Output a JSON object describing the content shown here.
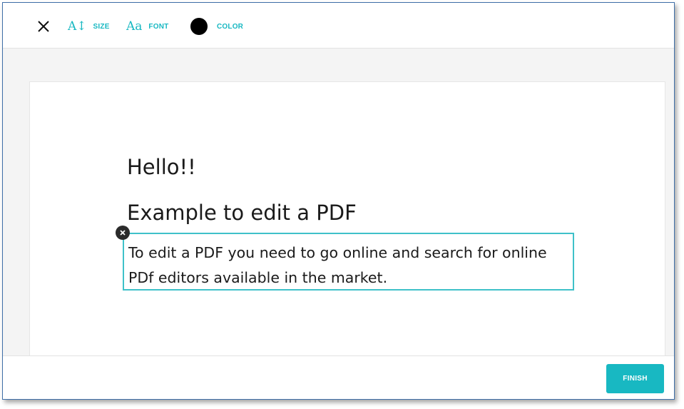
{
  "toolbar": {
    "close_icon": "close-icon",
    "size": {
      "icon": "text-size-icon",
      "glyph": "A↕",
      "label": "SIZE"
    },
    "font": {
      "icon": "font-icon",
      "glyph": "Aa",
      "label": "FONT"
    },
    "color": {
      "icon": "color-swatch",
      "value": "#000000",
      "label": "COLOR"
    }
  },
  "document": {
    "heading1": "Hello!!",
    "heading2": "Example to edit a PDF",
    "editable_text": "To edit a PDF you need to go online and search for online PDf editors available in the market."
  },
  "footer": {
    "finish_label": "FINISH"
  },
  "colors": {
    "accent": "#18b8c2",
    "selection_border": "#3fc1c9",
    "workspace_bg": "#f4f4f4"
  }
}
